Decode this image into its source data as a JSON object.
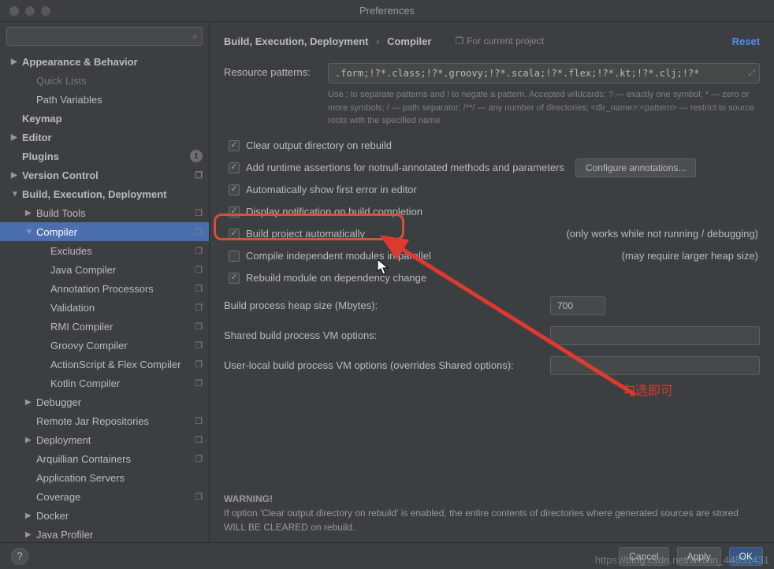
{
  "window": {
    "title": "Preferences"
  },
  "search": {
    "placeholder": ""
  },
  "sidebar": {
    "items": [
      {
        "label": "Appearance & Behavior",
        "arrow": "▶",
        "bold": true,
        "lvl": 0
      },
      {
        "label": "Quick Lists",
        "arrow": "",
        "bold": false,
        "lvl": 1,
        "faded": true
      },
      {
        "label": "Path Variables",
        "arrow": "",
        "bold": false,
        "lvl": 1
      },
      {
        "label": "Keymap",
        "arrow": "",
        "bold": true,
        "lvl": 0
      },
      {
        "label": "Editor",
        "arrow": "▶",
        "bold": true,
        "lvl": 0
      },
      {
        "label": "Plugins",
        "arrow": "",
        "bold": true,
        "lvl": 0,
        "badge": "1"
      },
      {
        "label": "Version Control",
        "arrow": "▶",
        "bold": true,
        "lvl": 0,
        "proj": true
      },
      {
        "label": "Build, Execution, Deployment",
        "arrow": "▼",
        "bold": true,
        "lvl": 0
      },
      {
        "label": "Build Tools",
        "arrow": "▶",
        "bold": false,
        "lvl": 1,
        "proj": true
      },
      {
        "label": "Compiler",
        "arrow": "▼",
        "bold": false,
        "lvl": 1,
        "proj": true,
        "selected": true
      },
      {
        "label": "Excludes",
        "arrow": "",
        "bold": false,
        "lvl": 2,
        "proj": true
      },
      {
        "label": "Java Compiler",
        "arrow": "",
        "bold": false,
        "lvl": 2,
        "proj": true
      },
      {
        "label": "Annotation Processors",
        "arrow": "",
        "bold": false,
        "lvl": 2,
        "proj": true
      },
      {
        "label": "Validation",
        "arrow": "",
        "bold": false,
        "lvl": 2,
        "proj": true
      },
      {
        "label": "RMI Compiler",
        "arrow": "",
        "bold": false,
        "lvl": 2,
        "proj": true
      },
      {
        "label": "Groovy Compiler",
        "arrow": "",
        "bold": false,
        "lvl": 2,
        "proj": true
      },
      {
        "label": "ActionScript & Flex Compiler",
        "arrow": "",
        "bold": false,
        "lvl": 2,
        "proj": true
      },
      {
        "label": "Kotlin Compiler",
        "arrow": "",
        "bold": false,
        "lvl": 2,
        "proj": true
      },
      {
        "label": "Debugger",
        "arrow": "▶",
        "bold": false,
        "lvl": 1
      },
      {
        "label": "Remote Jar Repositories",
        "arrow": "",
        "bold": false,
        "lvl": 1,
        "proj": true
      },
      {
        "label": "Deployment",
        "arrow": "▶",
        "bold": false,
        "lvl": 1,
        "proj": true
      },
      {
        "label": "Arquillian Containers",
        "arrow": "",
        "bold": false,
        "lvl": 1,
        "proj": true
      },
      {
        "label": "Application Servers",
        "arrow": "",
        "bold": false,
        "lvl": 1
      },
      {
        "label": "Coverage",
        "arrow": "",
        "bold": false,
        "lvl": 1,
        "proj": true
      },
      {
        "label": "Docker",
        "arrow": "▶",
        "bold": false,
        "lvl": 1
      },
      {
        "label": "Java Profiler",
        "arrow": "▶",
        "bold": false,
        "lvl": 1
      }
    ]
  },
  "breadcrumb": {
    "a": "Build, Execution, Deployment",
    "b": "Compiler"
  },
  "for_project": "For current project",
  "reset": "Reset",
  "patterns": {
    "label": "Resource patterns:",
    "value": ".form;!?*.class;!?*.groovy;!?*.scala;!?*.flex;!?*.kt;!?*.clj;!?*",
    "hint": "Use ; to separate patterns and ! to negate a pattern. Accepted wildcards: ? — exactly one symbol; * — zero or more symbols; / — path separator; /**/ — any number of directories; <dir_name>:<pattern> — restrict to source roots with the specified name"
  },
  "checks": {
    "c1": "Clear output directory on rebuild",
    "c2": "Add runtime assertions for notnull-annotated methods and parameters",
    "c2_btn": "Configure annotations...",
    "c3": "Automatically show first error in editor",
    "c4": "Display notification on build completion",
    "c5": "Build project automatically",
    "c5_note": "(only works while not running / debugging)",
    "c6": "Compile independent modules in parallel",
    "c6_note": "(may require larger heap size)",
    "c7": "Rebuild module on dependency change"
  },
  "fields": {
    "heap_label": "Build process heap size (Mbytes):",
    "heap_value": "700",
    "shared_label": "Shared build process VM options:",
    "shared_value": "",
    "user_label": "User-local build process VM options (overrides Shared options):",
    "user_value": ""
  },
  "warning": {
    "title": "WARNING!",
    "text": "If option 'Clear output directory on rebuild' is enabled, the entire contents of directories where generated sources are stored WILL BE CLEARED on rebuild."
  },
  "annotation": "勾选即可",
  "footer": {
    "cancel": "Cancel",
    "apply": "Apply",
    "ok": "OK"
  },
  "watermark": "https://blog.csdn.net/weixin_44831431"
}
